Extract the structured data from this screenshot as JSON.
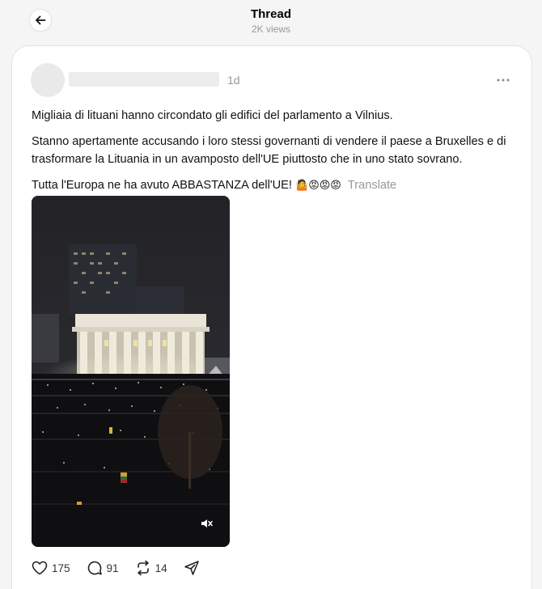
{
  "header": {
    "title": "Thread",
    "views": "2K views",
    "back_icon": "arrow-left-icon"
  },
  "post": {
    "time": "1d",
    "paragraphs": [
      "Migliaia di lituani hanno circondato gli edifici del parlamento a Vilnius.",
      "Stanno apertamente accusando i loro stessi governanti di vendere il paese a Bruxelles e di trasformare la Lituania in un avamposto dell'UE piuttosto che in uno stato sovrano."
    ],
    "last_line": "Tutta l'Europa ne ha avuto ABBASTANZA dell'UE!",
    "emojis": "🤷😡😡😡",
    "translate_label": "Translate",
    "video": {
      "muted": true,
      "mute_icon": "speaker-muted-icon"
    }
  },
  "actions": {
    "likes": "175",
    "replies": "91",
    "reposts": "14"
  }
}
